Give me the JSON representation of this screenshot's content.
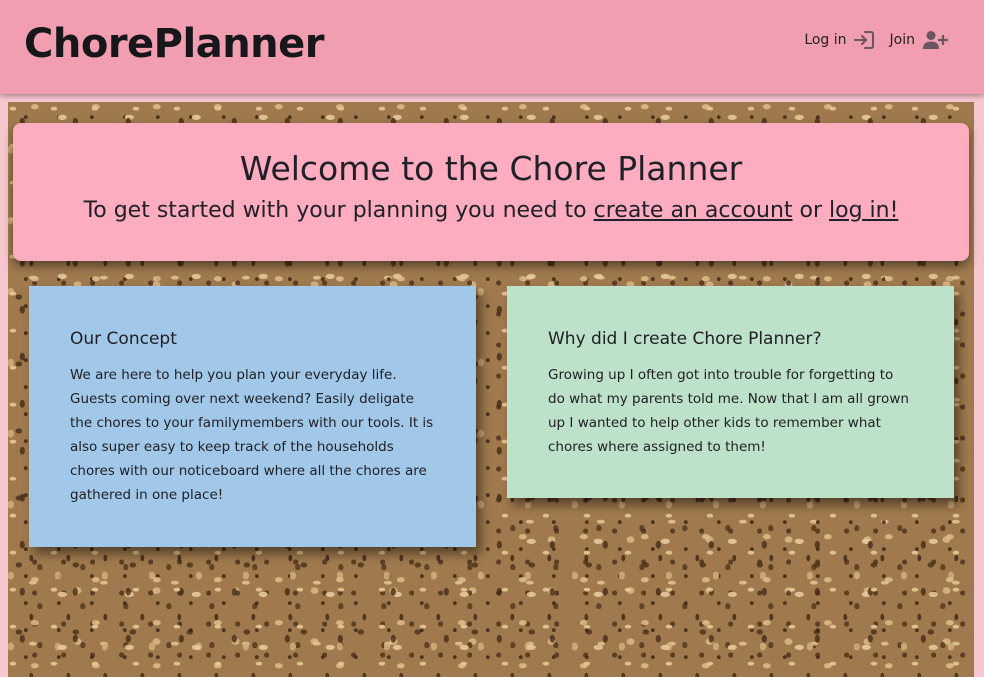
{
  "header": {
    "logo": "ChorePlanner",
    "nav": {
      "login_label": "Log in",
      "join_label": "Join"
    }
  },
  "welcome": {
    "title": "Welcome to the Chore Planner",
    "prefix": "To get started with your planning you need to ",
    "create_account_link": "create an account",
    "connector": " or ",
    "login_link": "log in!"
  },
  "cards": {
    "concept": {
      "title": "Our Concept",
      "body": "We are here to help you plan your everyday life. Guests coming over next weekend? Easily deligate the chores to your familymembers with our tools. It is also super easy to keep track of the households chores with our noticeboard where all the chores are gathered in one place!"
    },
    "why": {
      "title": "Why did I create Chore Planner?",
      "body": "Growing up I often got into trouble for forgetting to do what my parents told me. Now that I am all grown up I wanted to help other kids to remember what chores where assigned to them!"
    }
  },
  "colors": {
    "header_bg": "#f29eb1",
    "welcome_bg": "#feadc0",
    "card_blue": "#a1c7e9",
    "card_green": "#bde1c9",
    "text": "#1f1f24"
  },
  "icons": {
    "login": "login-arrow-icon",
    "join": "user-plus-icon"
  }
}
